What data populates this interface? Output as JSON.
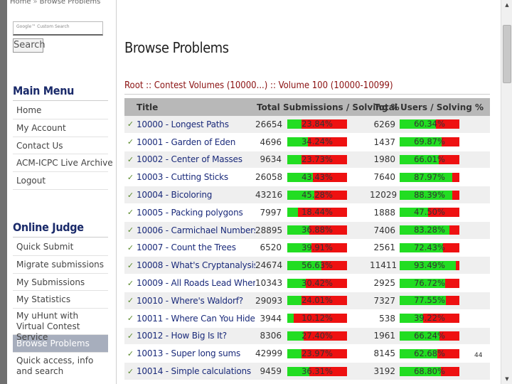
{
  "breadcrumb": {
    "home": "Home",
    "separator": "»",
    "current": "Browse Problems"
  },
  "search": {
    "placeholder": "Google™ Custom Search",
    "button_label": "Search"
  },
  "main_menu": {
    "title": "Main Menu",
    "items": [
      "Home",
      "My Account",
      "Contact Us",
      "ACM-ICPC Live Archive",
      "Logout"
    ]
  },
  "online_judge": {
    "title": "Online Judge",
    "items": [
      "Quick Submit",
      "Migrate submissions",
      "My Submissions",
      "My Statistics",
      "My uHunt with Virtual Contest Service",
      "Browse Problems",
      "Quick access, info and search"
    ]
  },
  "page_title": "Browse Problems",
  "volume_path": "Root :: Contest Volumes (10000...) :: Volume 100 (10000-10099)",
  "table": {
    "headers": {
      "title": "Title",
      "submissions": "Total Submissions / Solving %",
      "users": "Total Users / Solving %"
    },
    "rows": [
      {
        "id": "10000",
        "name": "Longest Paths",
        "submissions": "26654",
        "solving_pct": "23.84%",
        "solving_frac": 0.2384,
        "users": "6269",
        "users_pct": "60.34%",
        "users_frac": 0.6034
      },
      {
        "id": "10001",
        "name": "Garden of Eden",
        "submissions": "4696",
        "solving_pct": "34.24%",
        "solving_frac": 0.3424,
        "users": "1437",
        "users_pct": "69.87%",
        "users_frac": 0.6987
      },
      {
        "id": "10002",
        "name": "Center of Masses",
        "submissions": "9634",
        "solving_pct": "23.73%",
        "solving_frac": 0.2373,
        "users": "1980",
        "users_pct": "66.01%",
        "users_frac": 0.6601
      },
      {
        "id": "10003",
        "name": "Cutting Sticks",
        "submissions": "26058",
        "solving_pct": "43.43%",
        "solving_frac": 0.4343,
        "users": "7640",
        "users_pct": "87.97%",
        "users_frac": 0.8797
      },
      {
        "id": "10004",
        "name": "Bicoloring",
        "submissions": "43216",
        "solving_pct": "45.28%",
        "solving_frac": 0.4528,
        "users": "12029",
        "users_pct": "88.39%",
        "users_frac": 0.8839
      },
      {
        "id": "10005",
        "name": "Packing polygons",
        "submissions": "7997",
        "solving_pct": "18.44%",
        "solving_frac": 0.1844,
        "users": "1888",
        "users_pct": "47.50%",
        "users_frac": 0.475
      },
      {
        "id": "10006",
        "name": "Carmichael Numbers",
        "submissions": "28895",
        "solving_pct": "36.88%",
        "solving_frac": 0.3688,
        "users": "7406",
        "users_pct": "83.28%",
        "users_frac": 0.8328
      },
      {
        "id": "10007",
        "name": "Count the Trees",
        "submissions": "6520",
        "solving_pct": "39.91%",
        "solving_frac": 0.3991,
        "users": "2561",
        "users_pct": "72.43%",
        "users_frac": 0.7243
      },
      {
        "id": "10008",
        "name": "What's Cryptanalysis?",
        "submissions": "24674",
        "solving_pct": "56.63%",
        "solving_frac": 0.5663,
        "users": "11411",
        "users_pct": "93.49%",
        "users_frac": 0.9349
      },
      {
        "id": "10009",
        "name": "All Roads Lead Where?",
        "submissions": "10343",
        "solving_pct": "30.42%",
        "solving_frac": 0.3042,
        "users": "2925",
        "users_pct": "76.72%",
        "users_frac": 0.7672
      },
      {
        "id": "10010",
        "name": "Where's Waldorf?",
        "submissions": "29093",
        "solving_pct": "24.01%",
        "solving_frac": 0.2401,
        "users": "7327",
        "users_pct": "77.55%",
        "users_frac": 0.7755
      },
      {
        "id": "10011",
        "name": "Where Can You Hide?",
        "submissions": "3944",
        "solving_pct": "10.12%",
        "solving_frac": 0.1012,
        "users": "538",
        "users_pct": "39.22%",
        "users_frac": 0.3922
      },
      {
        "id": "10012",
        "name": "How Big Is It?",
        "submissions": "8306",
        "solving_pct": "27.40%",
        "solving_frac": 0.274,
        "users": "1961",
        "users_pct": "66.24%",
        "users_frac": 0.6624
      },
      {
        "id": "10013",
        "name": "Super long sums",
        "submissions": "42999",
        "solving_pct": "23.97%",
        "solving_frac": 0.2397,
        "users": "8145",
        "users_pct": "62.68%",
        "users_frac": 0.6268
      },
      {
        "id": "10014",
        "name": "Simple calculations",
        "submissions": "9459",
        "solving_pct": "36.31%",
        "solving_frac": 0.3631,
        "users": "3192",
        "users_pct": "68.80%",
        "users_frac": 0.688
      }
    ]
  },
  "page_number": "44",
  "colors": {
    "bar_solved": "#22dd22",
    "bar_unsolved": "#ee1111",
    "menu_title": "#1a2a6a",
    "volume_path": "#8a1010",
    "active_menu": "#a7aebd"
  },
  "icons": {
    "row_marker": "pin-icon",
    "scroll_up": "triangle-up-icon",
    "scroll_down": "triangle-down-icon"
  }
}
